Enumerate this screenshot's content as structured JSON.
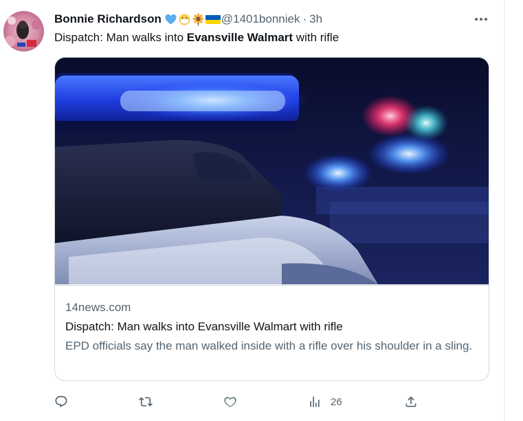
{
  "tweet": {
    "author_name": "Bonnie Richardson",
    "author_emojis": [
      "blue-heart",
      "face-with-medical-mask",
      "sunflower",
      "ukraine-flag"
    ],
    "handle": "@1401bonniek",
    "separator": "·",
    "time": "3h",
    "text_before": "Dispatch: Man walks into ",
    "text_bold": "Evansville Walmart",
    "text_after": " with rifle"
  },
  "card": {
    "image_subject": "police car emergency lights at night",
    "domain": "14news.com",
    "title": "Dispatch: Man walks into Evansville Walmart with rifle",
    "description": "EPD officials say the man walked inside with a rifle over his shoulder in a sling."
  },
  "actions": {
    "reply_icon": "reply-icon",
    "retweet_icon": "retweet-icon",
    "like_icon": "like-icon",
    "views_icon": "views-icon",
    "views_count": "26",
    "share_icon": "share-icon"
  },
  "colors": {
    "text_primary": "#0f1419",
    "text_secondary": "#536471",
    "border": "#cfd9de"
  }
}
